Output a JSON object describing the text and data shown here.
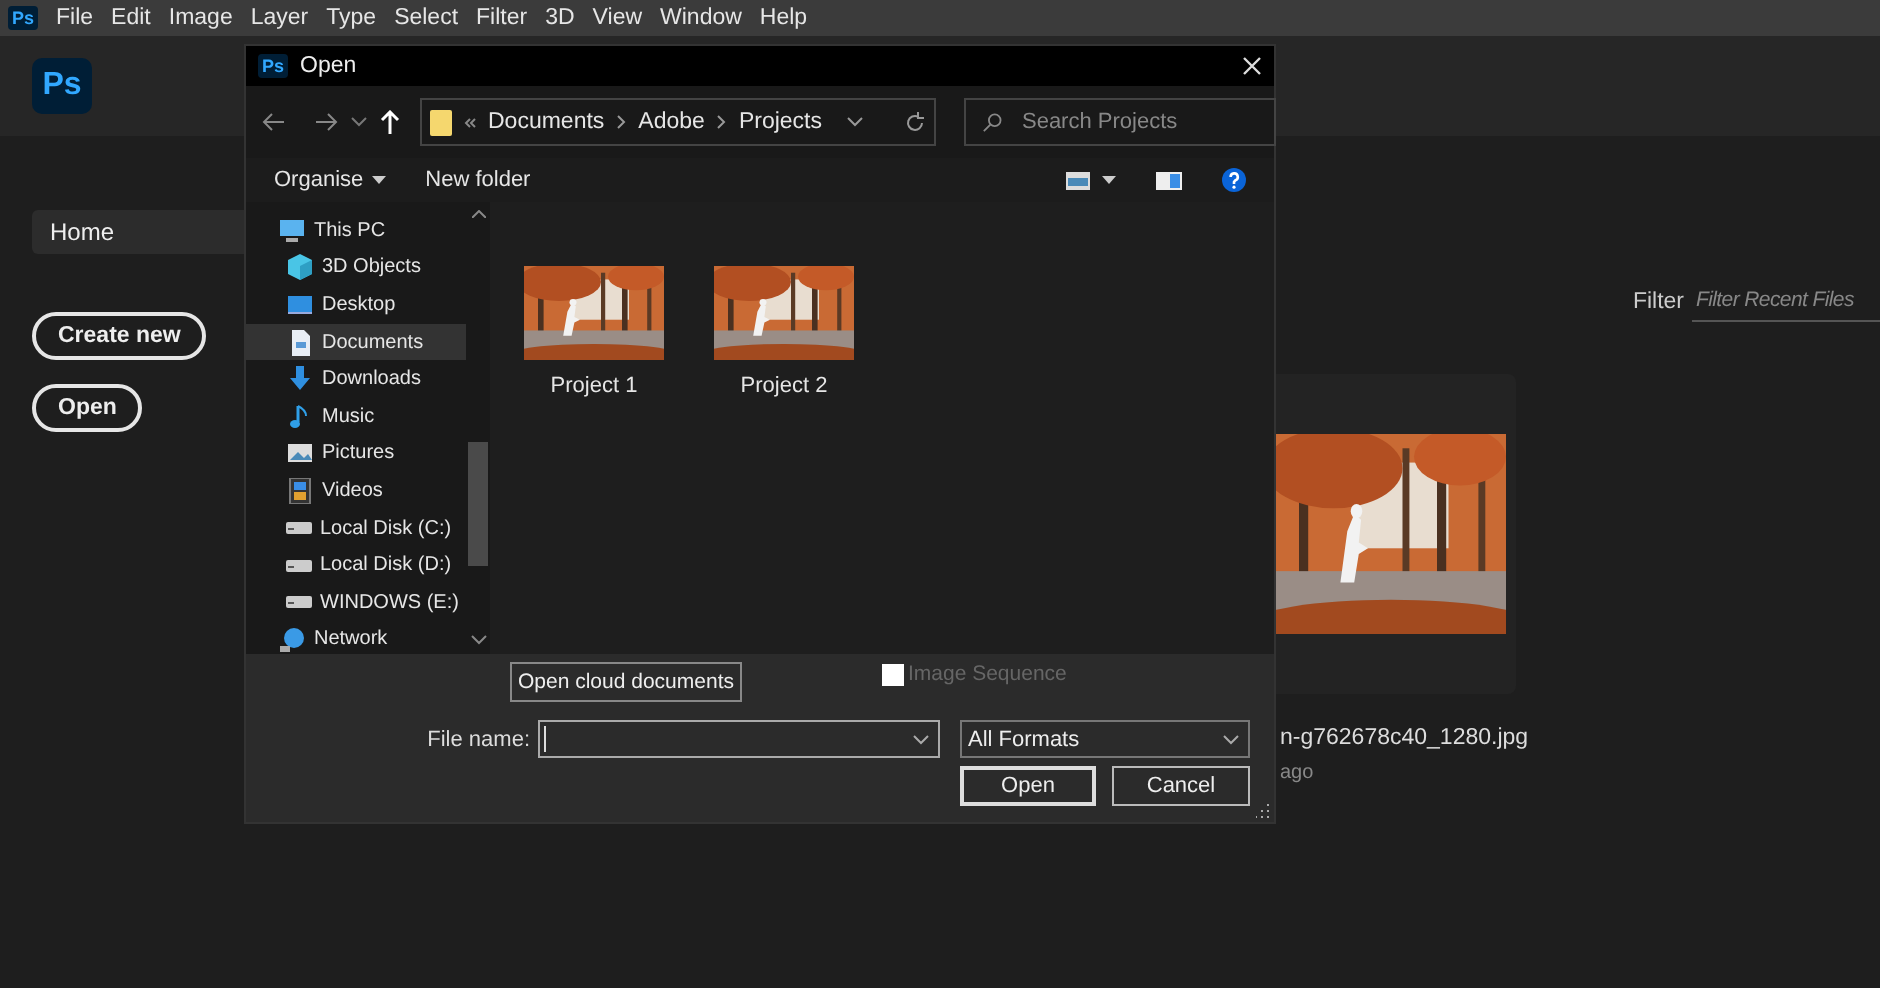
{
  "menu_bar": {
    "logo": "Ps",
    "items": [
      "File",
      "Edit",
      "Image",
      "Layer",
      "Type",
      "Select",
      "Filter",
      "3D",
      "View",
      "Window",
      "Help"
    ]
  },
  "app": {
    "logo": "Ps"
  },
  "sidebar": {
    "home": {
      "label": "Home",
      "selected": true
    },
    "buttons": [
      "Create new",
      "Open"
    ]
  },
  "filter": {
    "label": "Filter",
    "placeholder": "Filter Recent Files"
  },
  "recent_file": {
    "name": "n-g762678c40_1280.jpg",
    "time": "ago"
  },
  "dialog": {
    "title": "Open",
    "logo": "Ps",
    "breadcrumb": [
      "Documents",
      "Adobe",
      "Projects"
    ],
    "search_placeholder": "Search Projects",
    "toolbar": [
      "Organise",
      "New folder"
    ],
    "nav": [
      {
        "label": "This PC",
        "kind": "pc",
        "selected": false,
        "children": [
          {
            "label": "3D Objects",
            "kind": "cube",
            "selected": false
          },
          {
            "label": "Desktop",
            "kind": "desktop",
            "selected": false
          },
          {
            "label": "Documents",
            "kind": "document",
            "selected": true
          },
          {
            "label": "Downloads",
            "kind": "download",
            "selected": false
          },
          {
            "label": "Music",
            "kind": "music",
            "selected": false
          },
          {
            "label": "Pictures",
            "kind": "pictures",
            "selected": false
          },
          {
            "label": "Videos",
            "kind": "videos",
            "selected": false
          },
          {
            "label": "Local Disk (C:)",
            "kind": "disk",
            "selected": false
          },
          {
            "label": "Local Disk (D:)",
            "kind": "disk",
            "selected": false
          },
          {
            "label": "WINDOWS (E:)",
            "kind": "disk",
            "selected": false
          }
        ]
      },
      {
        "label": "Network",
        "kind": "network",
        "selected": false
      }
    ],
    "files": [
      {
        "name": "Project 1"
      },
      {
        "name": "Project 2"
      }
    ],
    "cloud_button": "Open cloud documents",
    "image_sequence": {
      "label": "Image Sequence",
      "checked": false,
      "disabled": true
    },
    "file_name": {
      "label": "File name:"
    },
    "format": "All Formats",
    "buttons": [
      "Open",
      "Cancel"
    ]
  }
}
